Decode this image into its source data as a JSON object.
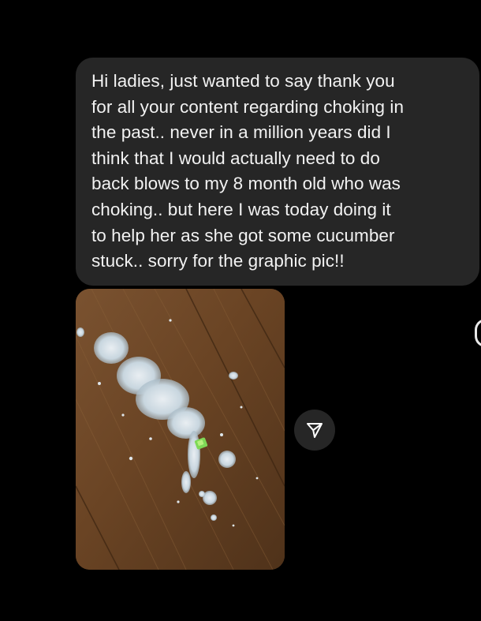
{
  "message": {
    "text": "Hi ladies, just wanted to say thank you\nfor all your content regarding choking in\nthe past.. never in a million years did I\nthink that I would actually need to do\nback blows to my 8 month old who was\nchoking.. but here I was today doing it\nto help her as she got some cucumber\nstuck.. sorry for the graphic pic!!"
  },
  "attachment": {
    "type": "photo"
  },
  "icons": {
    "share": "paper-plane-icon"
  },
  "colors": {
    "background": "#000000",
    "bubble": "#262626",
    "text": "#f2f2f2",
    "share_button": "#262626"
  }
}
